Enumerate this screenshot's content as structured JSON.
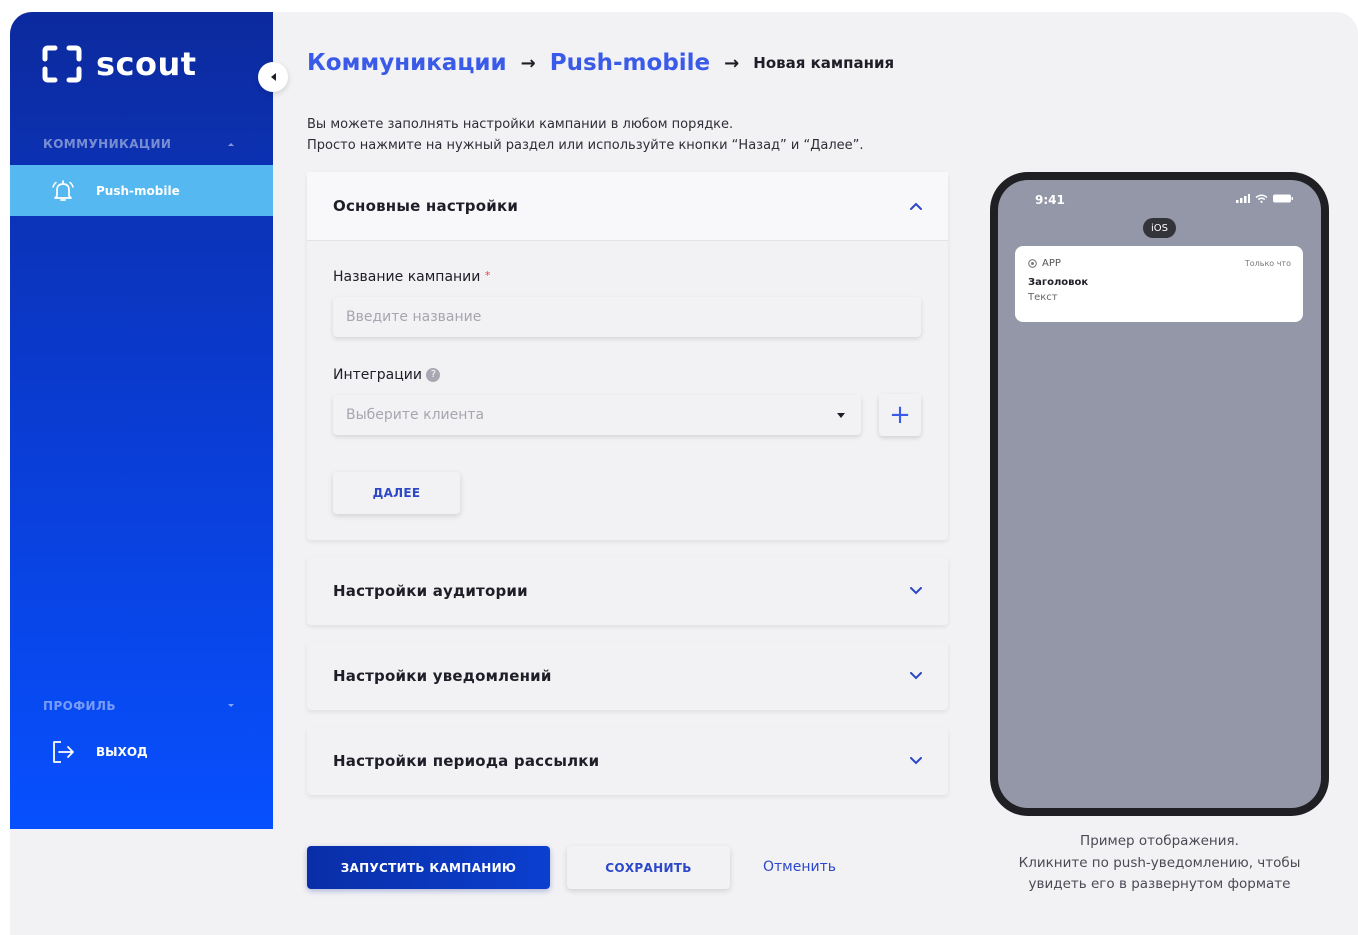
{
  "sidebar": {
    "logo_text": "scout",
    "sections": [
      {
        "title": "КОММУНИКАЦИИ",
        "items": [
          {
            "label": "Push-mobile",
            "icon": "bell-icon",
            "active": true
          }
        ]
      },
      {
        "title": "ПРОФИЛЬ",
        "items": [
          {
            "label": "ВЫХОД",
            "icon": "logout-icon",
            "active": false
          }
        ]
      }
    ],
    "accent_active": "#55b8f0"
  },
  "breadcrumb": {
    "level1": "Коммуникации",
    "level2": "Push-mobile",
    "current": "Новая кампания",
    "separator": "→"
  },
  "intro": {
    "line1": "Вы можете заполнять настройки кампании в любом порядке.",
    "line2": "Просто нажмите на нужный раздел или используйте кнопки “Назад” и “Далее”."
  },
  "panels": {
    "basic": {
      "title": "Основные настройки",
      "name_label": "Название кампании",
      "name_required": "*",
      "name_placeholder": "Введите название",
      "integrations_label": "Интеграции",
      "integrations_help": "?",
      "integrations_placeholder": "Выберите клиента",
      "plus_label": "+",
      "next_label": "ДАЛЕЕ"
    },
    "audience": {
      "title": "Настройки аудитории"
    },
    "notifications": {
      "title": "Настройки уведомлений"
    },
    "period": {
      "title": "Настройки периода рассылки"
    }
  },
  "actions": {
    "launch_label": "ЗАПУСТИТЬ КАМПАНИЮ",
    "save_label": "СОХРАНИТЬ",
    "cancel_label": "Отменить"
  },
  "preview": {
    "time": "9:41",
    "platform": "iOS",
    "notification": {
      "app": "APP",
      "time": "Только что",
      "title": "Заголовок",
      "text": "Текст"
    },
    "caption_line1": "Пример отображения.",
    "caption_line2": "Кликните по push-уведомлению, чтобы",
    "caption_line3": "увидеть его в развернутом формате"
  },
  "colors": {
    "primary": "#0b3fcf",
    "link": "#3a5ae8",
    "sidebar_top": "#0c2a9e",
    "sidebar_bottom": "#0750ff"
  }
}
